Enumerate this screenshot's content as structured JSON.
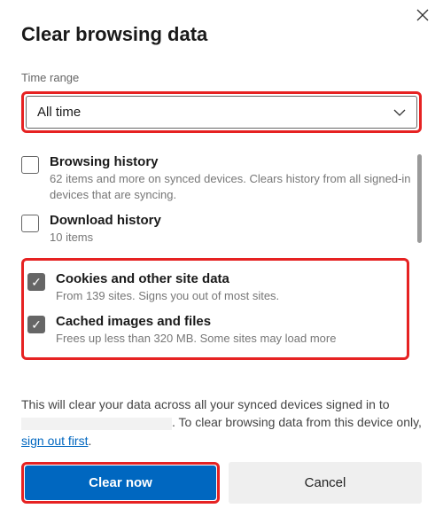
{
  "title": "Clear browsing data",
  "timeRange": {
    "label": "Time range",
    "value": "All time"
  },
  "options": [
    {
      "checked": false,
      "title": "Browsing history",
      "desc": "62 items and more on synced devices. Clears history from all signed-in devices that are syncing."
    },
    {
      "checked": false,
      "title": "Download history",
      "desc": "10 items"
    },
    {
      "checked": true,
      "title": "Cookies and other site data",
      "desc": "From 139 sites. Signs you out of most sites."
    },
    {
      "checked": true,
      "title": "Cached images and files",
      "desc": "Frees up less than 320 MB. Some sites may load more"
    }
  ],
  "footer": {
    "part1": "This will clear your data across all your synced devices signed in to ",
    "part2": ". To clear browsing data from this device only, ",
    "linkText": "sign out first",
    "part3": "."
  },
  "buttons": {
    "primary": "Clear now",
    "secondary": "Cancel"
  }
}
